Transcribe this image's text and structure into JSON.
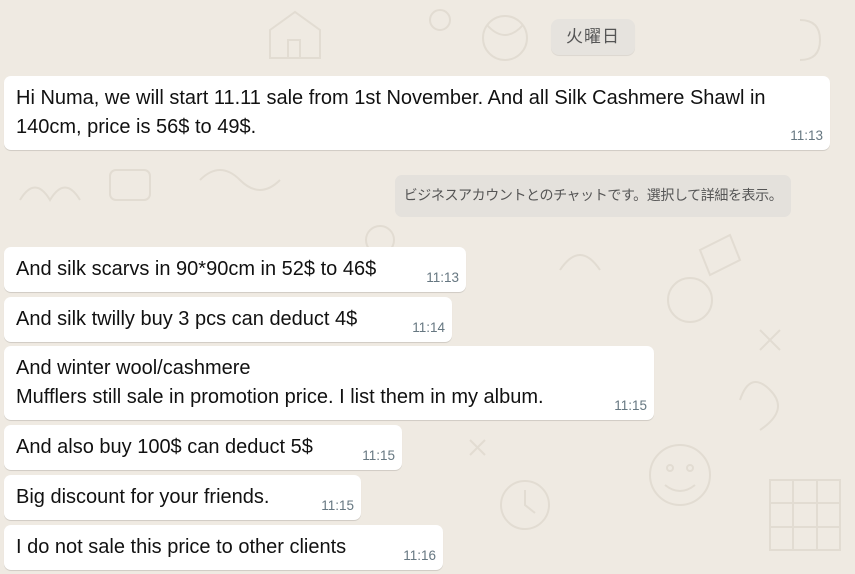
{
  "theme": {
    "background": "#efeae2",
    "bubble": "#ffffff",
    "time_color": "#667781",
    "system_chip": "#e4e1dc"
  },
  "date_divider": "火曜日",
  "system_notice": "ビジネスアカウントとのチャットです。選択して詳細を表示。",
  "messages": [
    {
      "text": "Hi Numa, we will start 11.11 sale from  1st November.  And all Silk Cashmere Shawl in 140cm, price is 56$ to 49$.",
      "time": "11:13"
    },
    {
      "text": "And silk scarvs in 90*90cm in 52$ to 46$",
      "time": "11:13"
    },
    {
      "text": "And silk twilly buy 3 pcs can deduct 4$",
      "time": "11:14"
    },
    {
      "text": "And winter wool/cashmere\nMufflers still sale in promotion price. I list them in my album.",
      "time": "11:15"
    },
    {
      "text": "And also buy 100$ can deduct 5$",
      "time": "11:15"
    },
    {
      "text": "Big discount for your friends.",
      "time": "11:15"
    },
    {
      "text": "I do not sale this price to other clients",
      "time": "11:16"
    }
  ]
}
